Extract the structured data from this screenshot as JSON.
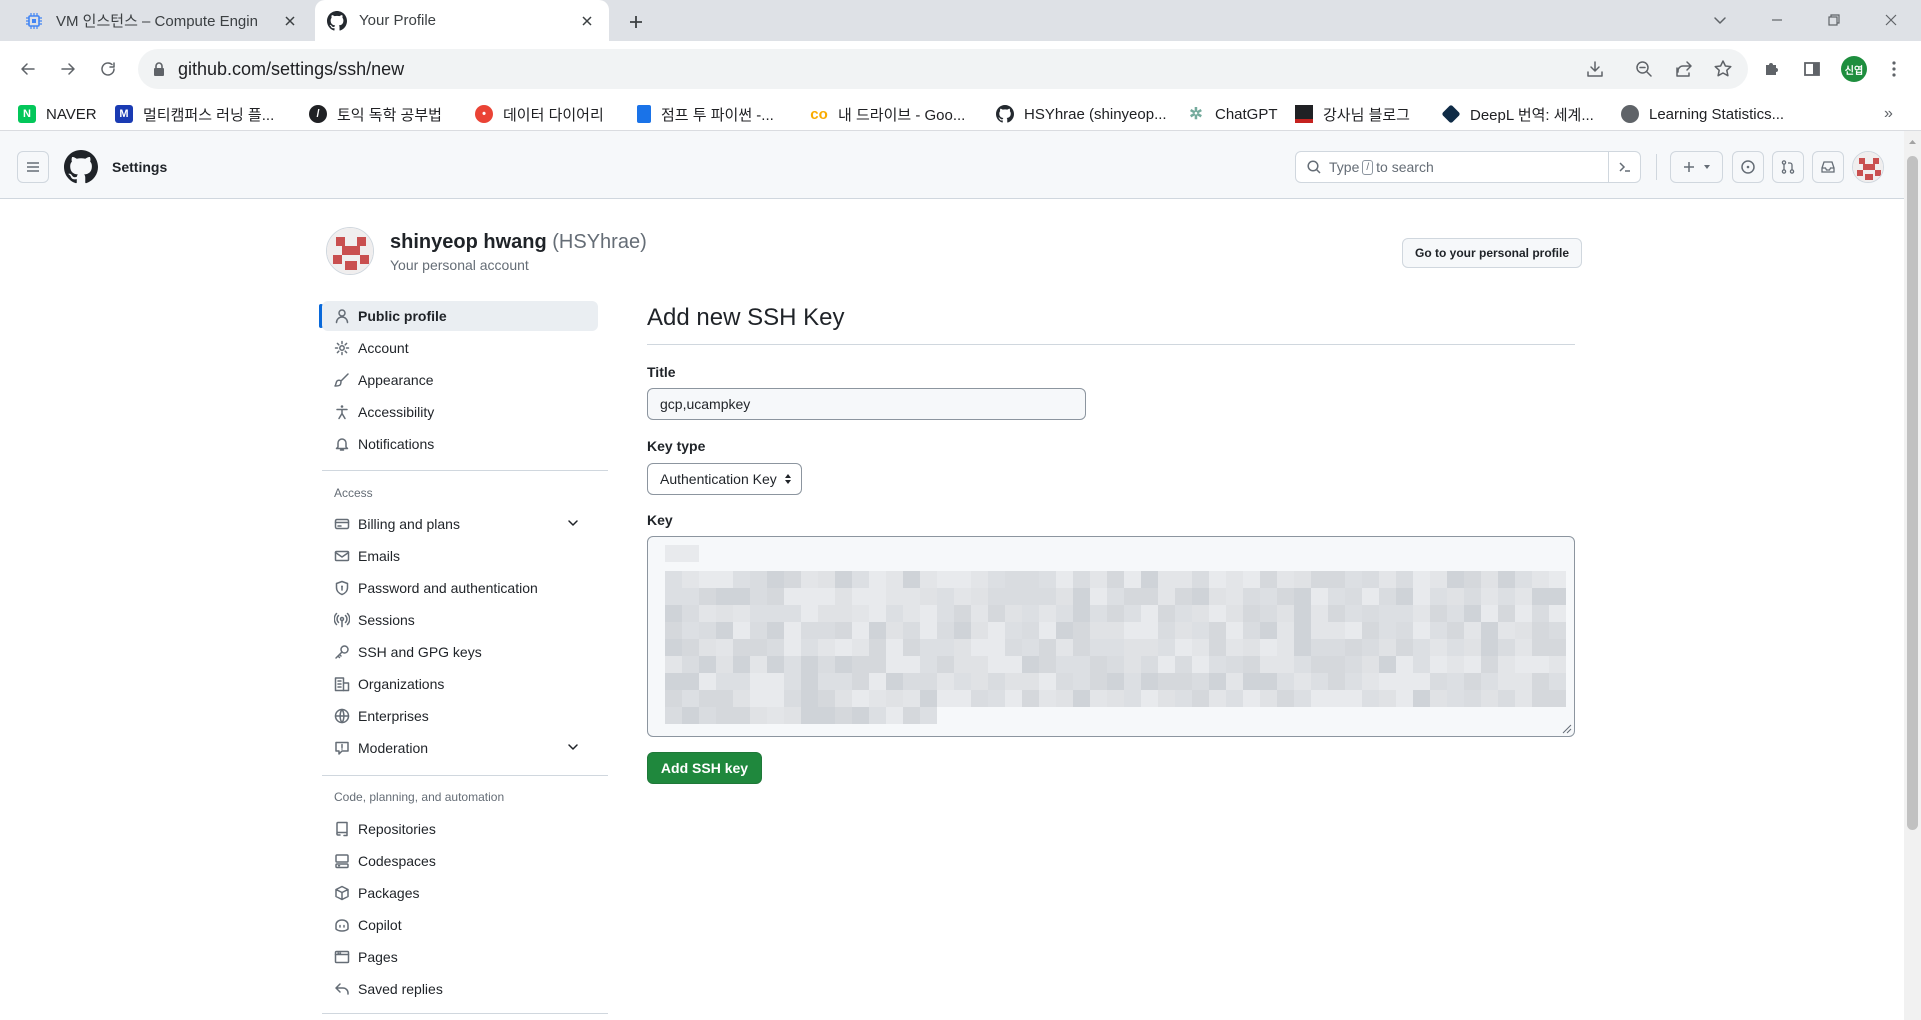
{
  "browser": {
    "tabs": [
      {
        "title": "VM 인스턴스 – Compute Engin",
        "active": false,
        "icon": "gcp-compute-icon"
      },
      {
        "title": "Your Profile",
        "active": true,
        "icon": "github-icon"
      }
    ],
    "url": "github.com/settings/ssh/new",
    "profile_initials": "신엽",
    "bookmarks": [
      {
        "label": "NAVER",
        "icon": "naver-icon",
        "color": "#03c75a",
        "glyph": "N"
      },
      {
        "label": "멀티캠퍼스 러닝 플...",
        "icon": "multicampus-icon",
        "color": "#1a3bb3",
        "glyph": "M"
      },
      {
        "label": "토익 독학 공부법",
        "icon": "pen-icon",
        "color": "#202124",
        "glyph": "/"
      },
      {
        "label": "데이터 다이어리",
        "icon": "diary-icon",
        "color": "#ea4335",
        "glyph": "•"
      },
      {
        "label": "점프 투 파이썬 -...",
        "icon": "book-icon",
        "color": "#1a73e8",
        "glyph": "▮"
      },
      {
        "label": "내 드라이브 - Goo...",
        "icon": "drive-icon",
        "color": "#f9ab00",
        "glyph": "∞"
      },
      {
        "label": "HSYhrae (shinyeop...",
        "icon": "github-icon",
        "color": "#202124",
        "glyph": ""
      },
      {
        "label": "ChatGPT",
        "icon": "chatgpt-icon",
        "color": "#74aa9c",
        "glyph": "✲"
      },
      {
        "label": "강사님 블로그",
        "icon": "blog-icon",
        "color": "#202124",
        "glyph": ""
      },
      {
        "label": "DeepL 번역: 세계...",
        "icon": "deepl-icon",
        "color": "#0f2b46",
        "glyph": "◆"
      },
      {
        "label": "Learning Statistics...",
        "icon": "globe-icon",
        "color": "#5f6368",
        "glyph": "◎"
      }
    ]
  },
  "header": {
    "context": "Settings",
    "search_text_pre": "Type",
    "search_key": "/",
    "search_text_post": "to search"
  },
  "profile": {
    "name": "shinyeop hwang",
    "handle": "(HSYhrae)",
    "subtitle": "Your personal account",
    "go_button": "Go to your personal profile"
  },
  "sidebar": {
    "top_items": [
      {
        "label": "Public profile",
        "icon": "person-icon",
        "active": true
      },
      {
        "label": "Account",
        "icon": "gear-icon"
      },
      {
        "label": "Appearance",
        "icon": "paintbrush-icon"
      },
      {
        "label": "Accessibility",
        "icon": "accessibility-icon"
      },
      {
        "label": "Notifications",
        "icon": "bell-icon"
      }
    ],
    "access_title": "Access",
    "access_items": [
      {
        "label": "Billing and plans",
        "icon": "credit-card-icon",
        "expandable": true
      },
      {
        "label": "Emails",
        "icon": "mail-icon"
      },
      {
        "label": "Password and authentication",
        "icon": "shield-lock-icon"
      },
      {
        "label": "Sessions",
        "icon": "broadcast-icon"
      },
      {
        "label": "SSH and GPG keys",
        "icon": "key-icon"
      },
      {
        "label": "Organizations",
        "icon": "organization-icon"
      },
      {
        "label": "Enterprises",
        "icon": "globe-icon"
      },
      {
        "label": "Moderation",
        "icon": "report-icon",
        "expandable": true
      }
    ],
    "code_title": "Code, planning, and automation",
    "code_items": [
      {
        "label": "Repositories",
        "icon": "repo-icon"
      },
      {
        "label": "Codespaces",
        "icon": "codespaces-icon"
      },
      {
        "label": "Packages",
        "icon": "package-icon"
      },
      {
        "label": "Copilot",
        "icon": "copilot-icon"
      },
      {
        "label": "Pages",
        "icon": "browser-icon"
      },
      {
        "label": "Saved replies",
        "icon": "reply-icon"
      }
    ]
  },
  "form": {
    "heading": "Add new SSH Key",
    "title_label": "Title",
    "title_value": "gcp,ucampkey",
    "keytype_label": "Key type",
    "keytype_value": "Authentication Key",
    "key_label": "Key",
    "submit_label": "Add SSH key"
  },
  "colors": {
    "primary_button": "#1f883d",
    "active_indicator": "#0969da",
    "avatar_pattern": "#c94f4f"
  }
}
